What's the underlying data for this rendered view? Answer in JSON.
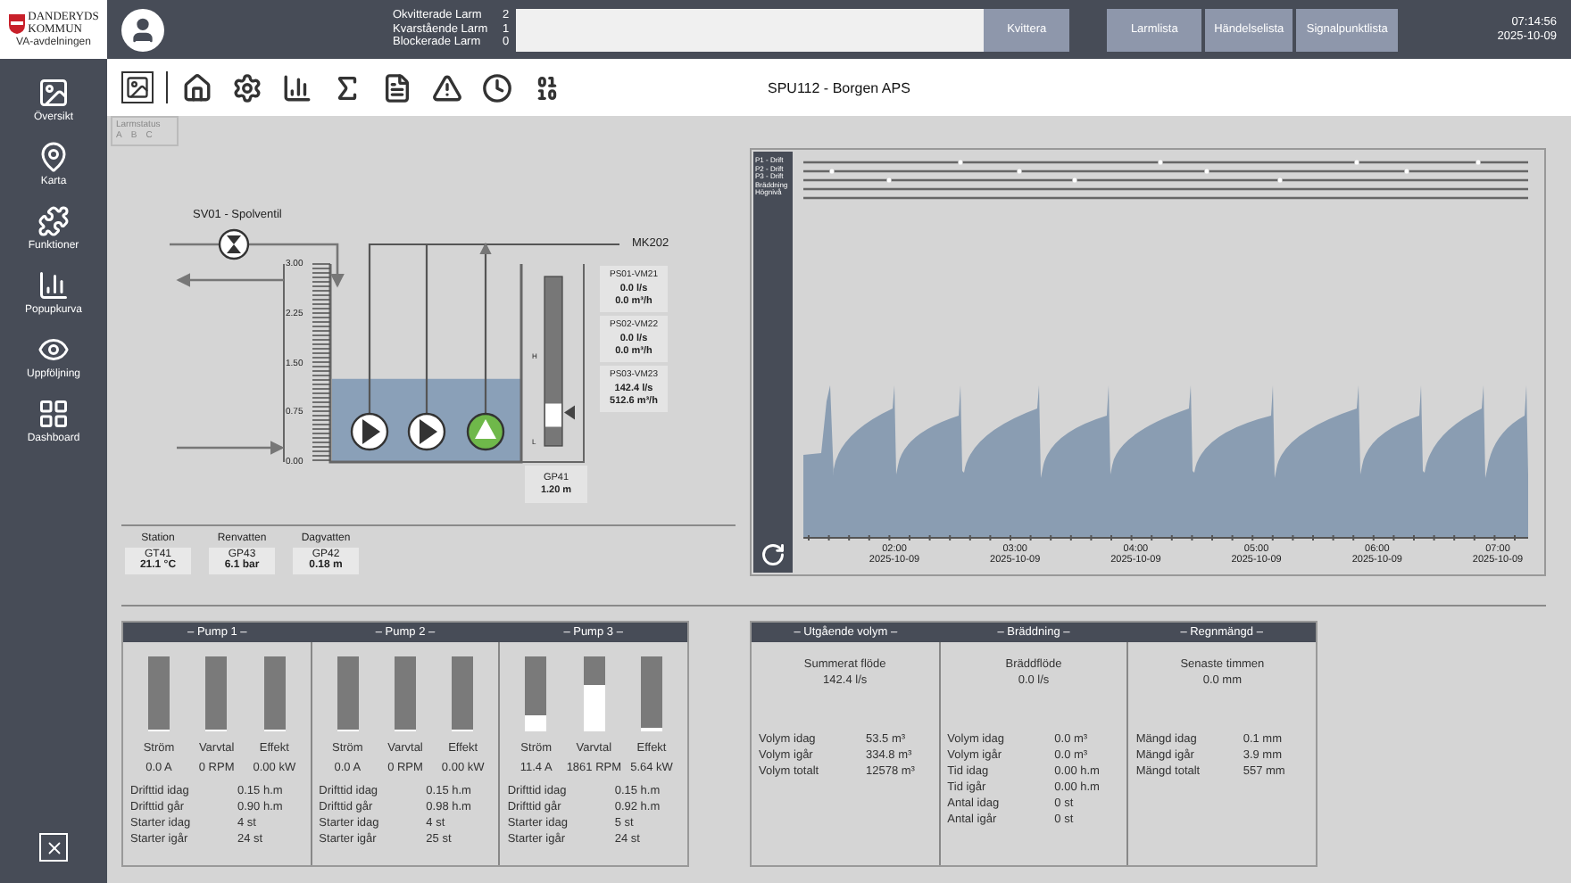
{
  "logo": {
    "lines": [
      "DANDERYDS",
      "KOMMUN"
    ],
    "subtitle": "VA-avdelningen"
  },
  "header": {
    "alarms": [
      {
        "label": "Okvitterade Larm",
        "count": "2"
      },
      {
        "label": "Kvarstående Larm",
        "count": "1"
      },
      {
        "label": "Blockerade Larm",
        "count": "0"
      }
    ],
    "ack_button": "Kvittera",
    "buttons": [
      "Larmlista",
      "Händelselista",
      "Signalpunktlista"
    ],
    "time": "07:14:56",
    "date": "2025-10-09"
  },
  "sidebar": {
    "items": [
      {
        "label": "Översikt"
      },
      {
        "label": "Karta"
      },
      {
        "label": "Funktioner"
      },
      {
        "label": "Popupkurva"
      },
      {
        "label": "Uppföljning"
      },
      {
        "label": "Dashboard"
      }
    ]
  },
  "toolbar": {
    "title": "SPU112 - Borgen APS"
  },
  "alarm_status": {
    "title": "Larmstatus",
    "classes": [
      "A",
      "B",
      "C"
    ]
  },
  "diagram": {
    "valve_label": "SV01 - Spolventil",
    "outlet_label": "MK202",
    "scale": [
      "3.00",
      "2.25",
      "1.50",
      "0.75",
      "0.00"
    ],
    "level": 0.42,
    "pumps": [
      {
        "running": false
      },
      {
        "running": false
      },
      {
        "running": true
      }
    ],
    "flows": [
      {
        "tag": "PS01-VM21",
        "flow": "0.0 l/s",
        "volume": "0.0 m³/h"
      },
      {
        "tag": "PS02-VM22",
        "flow": "0.0 l/s",
        "volume": "0.0 m³/h"
      },
      {
        "tag": "PS03-VM23",
        "flow": "142.4 l/s",
        "volume": "512.6 m³/h"
      }
    ],
    "gauge": {
      "tag": "GP41",
      "value": "1.20 m",
      "level": 0.25,
      "marks": [
        "H",
        "L"
      ]
    }
  },
  "stations": [
    {
      "label": "Station",
      "tag": "GT41",
      "value": "21.1 °C"
    },
    {
      "label": "Renvatten",
      "tag": "GP43",
      "value": "6.1 bar"
    },
    {
      "label": "Dagvatten",
      "tag": "GP42",
      "value": "0.18 m"
    }
  ],
  "trend": {
    "legend": [
      "P1 - Drift",
      "P2 - Drift",
      "P3 - Drift",
      "Bräddning",
      "Högnivå"
    ],
    "x_labels": [
      {
        "time": "02:00",
        "date": "2025-10-09"
      },
      {
        "time": "03:00",
        "date": "2025-10-09"
      },
      {
        "time": "04:00",
        "date": "2025-10-09"
      },
      {
        "time": "05:00",
        "date": "2025-10-09"
      },
      {
        "time": "06:00",
        "date": "2025-10-09"
      },
      {
        "time": "07:00",
        "date": "2025-10-09"
      }
    ]
  },
  "pumps": [
    {
      "title": "– Pump 1 –",
      "meters": [
        {
          "label": "Ström",
          "value": "0.0 A",
          "level": 0
        },
        {
          "label": "Varvtal",
          "value": "0 RPM",
          "level": 0
        },
        {
          "label": "Effekt",
          "value": "0.00 kW",
          "level": 0
        }
      ],
      "stats": [
        {
          "label": "Drifttid idag",
          "value": "0.15 h.m"
        },
        {
          "label": "Drifttid går",
          "value": "0.90 h.m"
        },
        {
          "label": "Starter idag",
          "value": "4 st"
        },
        {
          "label": "Starter igår",
          "value": "24 st"
        }
      ]
    },
    {
      "title": "– Pump 2 –",
      "meters": [
        {
          "label": "Ström",
          "value": "0.0 A",
          "level": 0
        },
        {
          "label": "Varvtal",
          "value": "0 RPM",
          "level": 0
        },
        {
          "label": "Effekt",
          "value": "0.00 kW",
          "level": 0
        }
      ],
      "stats": [
        {
          "label": "Drifttid idag",
          "value": "0.15 h.m"
        },
        {
          "label": "Drifttid går",
          "value": "0.98 h.m"
        },
        {
          "label": "Starter idag",
          "value": "4 st"
        },
        {
          "label": "Starter igår",
          "value": "25 st"
        }
      ]
    },
    {
      "title": "– Pump 3 –",
      "meters": [
        {
          "label": "Ström",
          "value": "11.4 A",
          "level": 0.22
        },
        {
          "label": "Varvtal",
          "value": "1861 RPM",
          "level": 0.62
        },
        {
          "label": "Effekt",
          "value": "5.64 kW",
          "level": 0.05
        }
      ],
      "stats": [
        {
          "label": "Drifttid idag",
          "value": "0.15 h.m"
        },
        {
          "label": "Drifttid går",
          "value": "0.92 h.m"
        },
        {
          "label": "Starter idag",
          "value": "5 st"
        },
        {
          "label": "Starter igår",
          "value": "24 st"
        }
      ]
    }
  ],
  "volumes": [
    {
      "title": "– Utgående volym –",
      "summary_label": "Summerat flöde",
      "summary_value": "142.4 l/s",
      "stats": [
        {
          "label": "Volym idag",
          "value": "53.5 m³"
        },
        {
          "label": "Volym igår",
          "value": "334.8 m³"
        },
        {
          "label": "Volym totalt",
          "value": "12578 m³"
        }
      ]
    },
    {
      "title": "– Bräddning –",
      "summary_label": "Bräddflöde",
      "summary_value": "0.0 l/s",
      "stats": [
        {
          "label": "Volym idag",
          "value": "0.0 m³"
        },
        {
          "label": "Volym igår",
          "value": "0.0 m³"
        },
        {
          "label": "Tid idag",
          "value": "0.00 h.m"
        },
        {
          "label": "Tid igår",
          "value": "0.00 h.m"
        },
        {
          "label": "Antal idag",
          "value": "0 st"
        },
        {
          "label": "Antal igår",
          "value": "0 st"
        }
      ]
    },
    {
      "title": "– Regnmängd –",
      "summary_label": "Senaste timmen",
      "summary_value": "0.0 mm",
      "stats": [
        {
          "label": "Mängd idag",
          "value": "0.1 mm"
        },
        {
          "label": "Mängd igår",
          "value": "3.9 mm"
        },
        {
          "label": "Mängd totalt",
          "value": "557 mm"
        }
      ]
    }
  ]
}
